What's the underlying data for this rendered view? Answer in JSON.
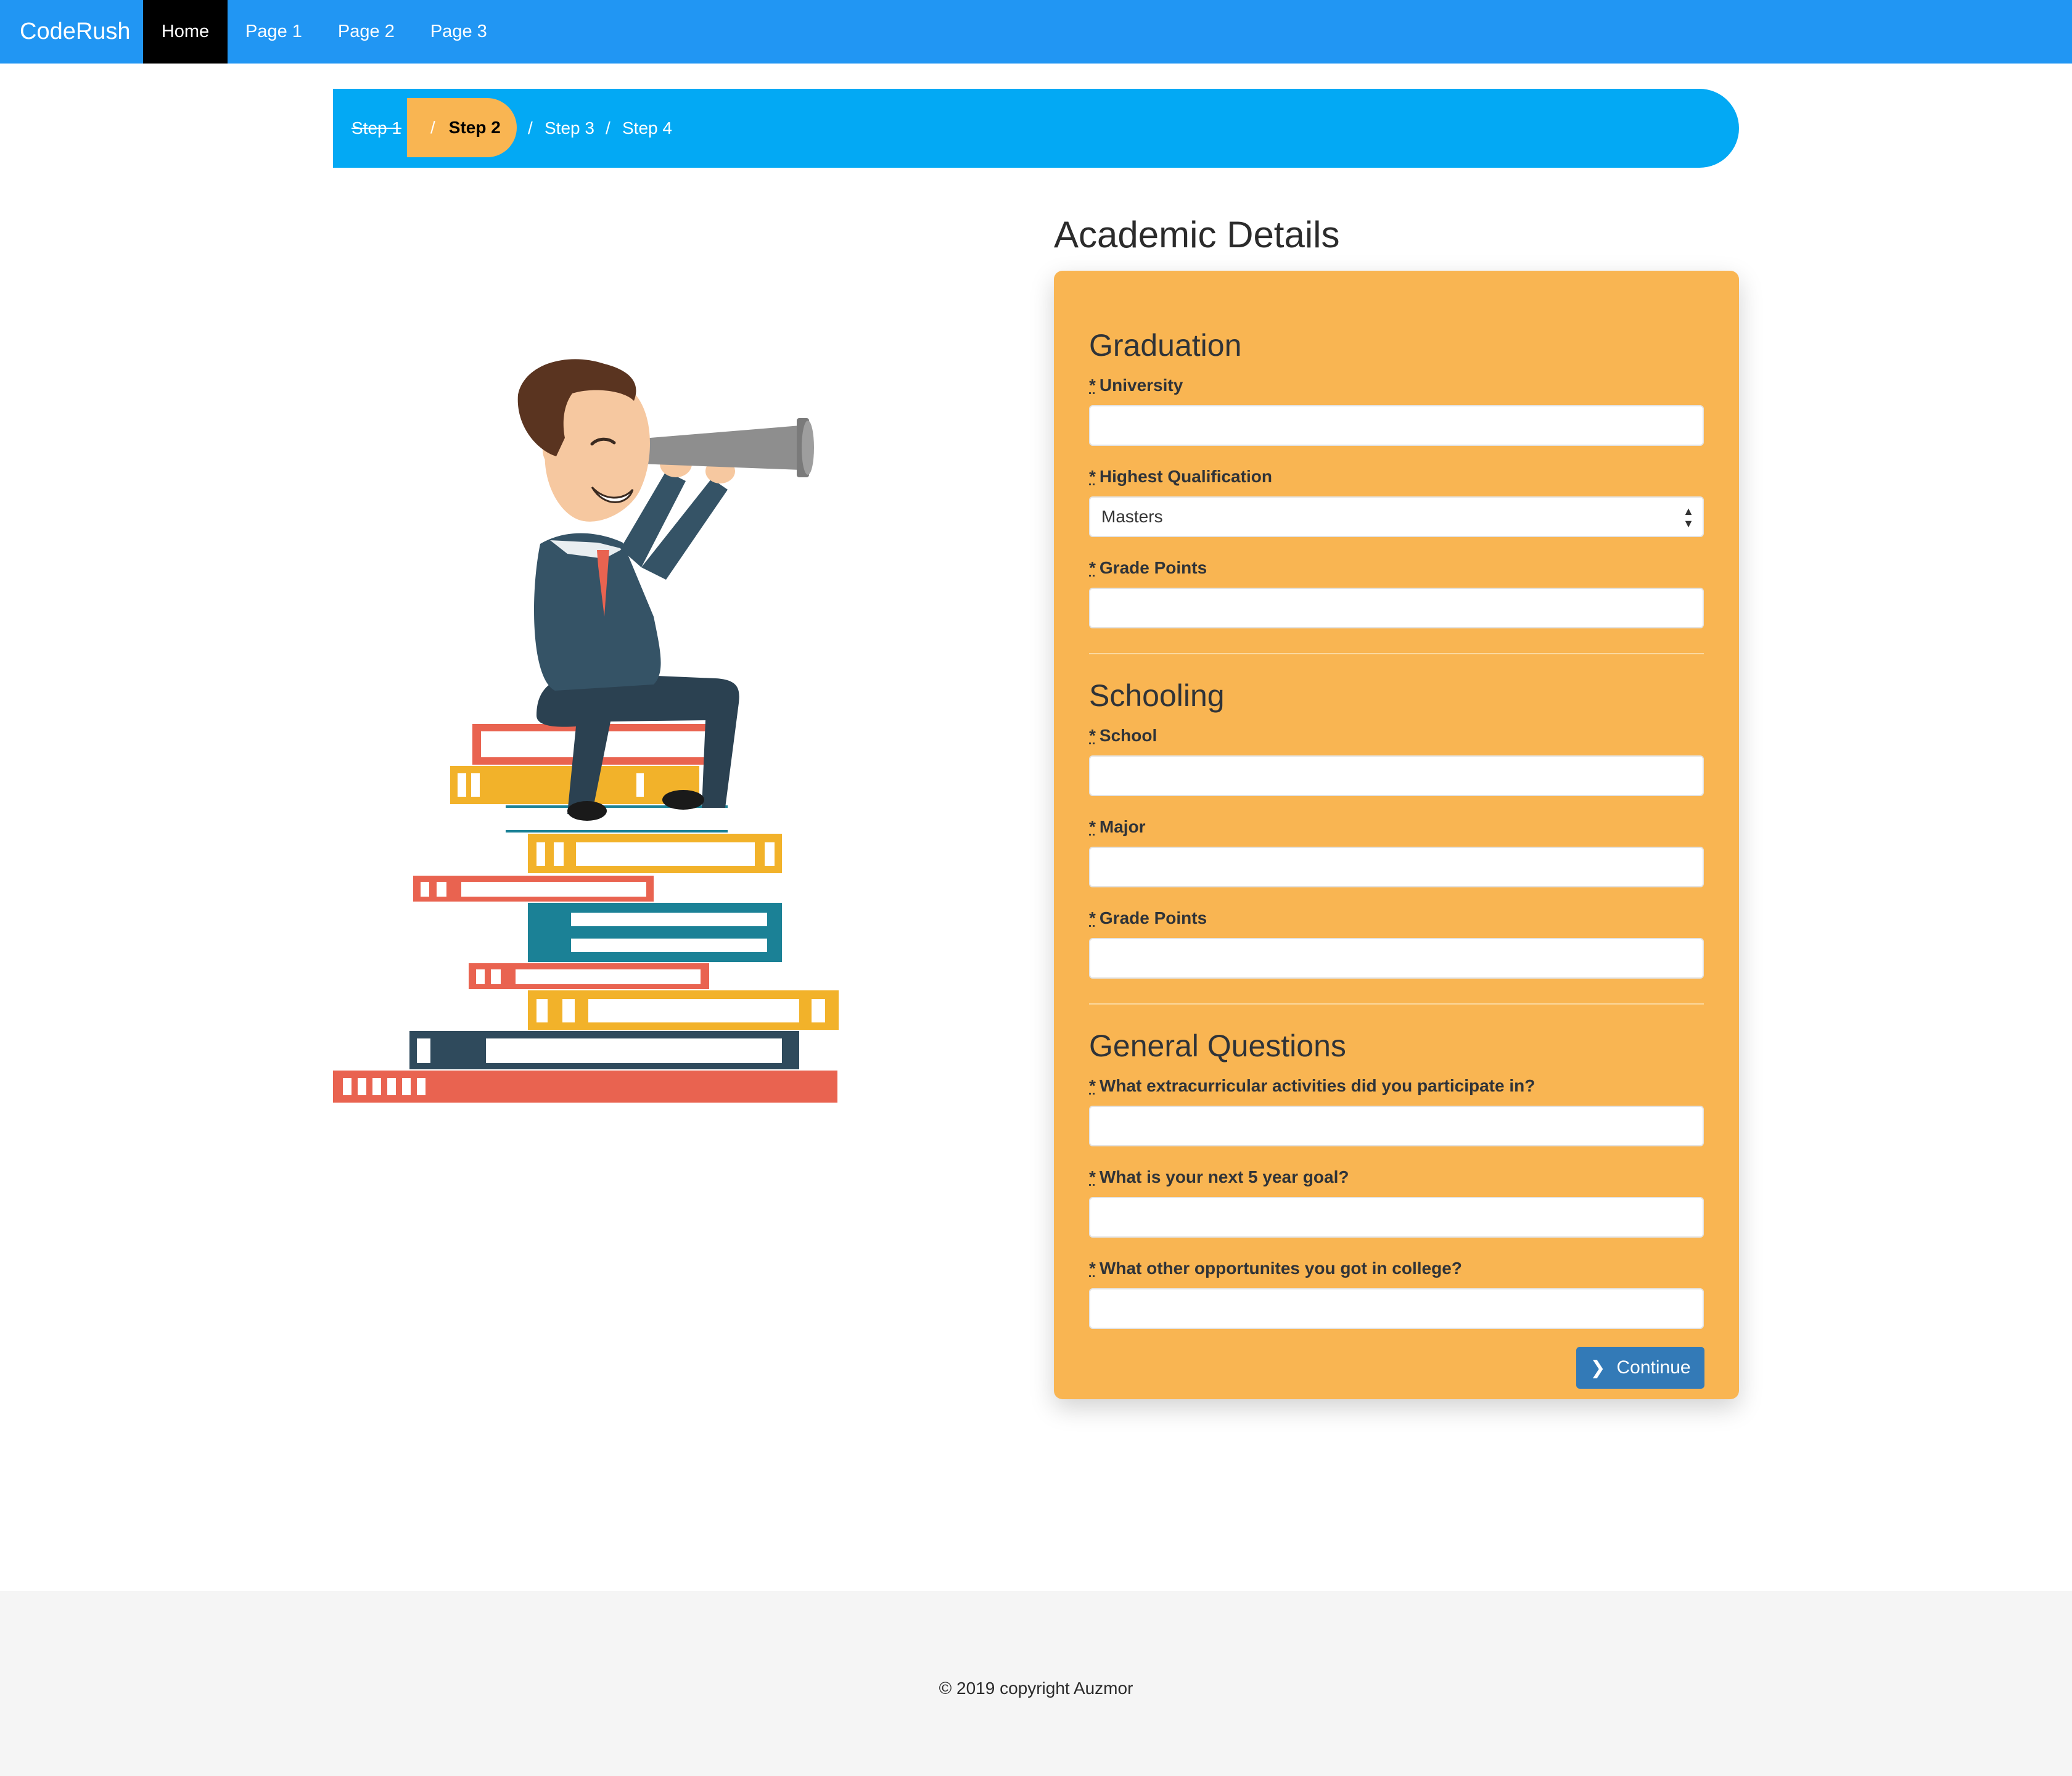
{
  "navbar": {
    "brand": "CodeRush",
    "items": [
      {
        "label": "Home",
        "active": true
      },
      {
        "label": "Page 1"
      },
      {
        "label": "Page 2"
      },
      {
        "label": "Page 3"
      }
    ]
  },
  "steps": {
    "items": [
      "Step 1",
      "Step 2",
      "Step 3",
      "Step 4"
    ],
    "separator": "/",
    "current": "Step 2",
    "completed": [
      "Step 1"
    ]
  },
  "form": {
    "title": "Academic Details",
    "graduation": {
      "title": "Graduation",
      "university_label": "University",
      "university_value": "",
      "qualification_label": "Highest Qualification",
      "qualification_value": "Masters",
      "grade_label": "Grade Points",
      "grade_value": ""
    },
    "schooling": {
      "title": "Schooling",
      "school_label": "School",
      "school_value": "",
      "major_label": "Major",
      "major_value": "",
      "grade_label": "Grade Points",
      "grade_value": ""
    },
    "general": {
      "title": "General Questions",
      "q1_label": "What extracurricular activities did you participate in?",
      "q1_value": "",
      "q2_label": "What is your next 5 year goal?",
      "q2_value": "",
      "q3_label": "What other opportunites you got in college?",
      "q3_value": ""
    },
    "required_marker": "*",
    "continue_label": "Continue",
    "continue_icon": "chevron-right-icon"
  },
  "footer": {
    "copyright": "© 2019 copyright Auzmor"
  },
  "colors": {
    "navbar": "#2196F3",
    "steps_bar": "#03A9F4",
    "active_step": "#F9B552",
    "panel": "#F9B552",
    "button": "#337AB7",
    "footer": "#F5F5F5"
  },
  "illustration": "man-with-telescope-on-books"
}
